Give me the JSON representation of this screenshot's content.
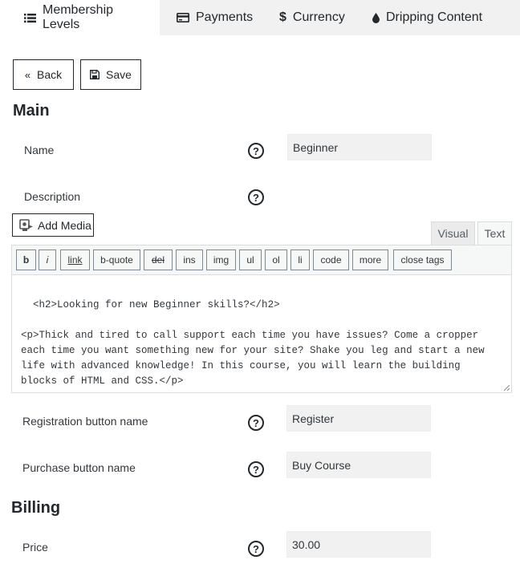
{
  "tabs": [
    {
      "label": "Membership Levels",
      "icon": "list-icon"
    },
    {
      "label": "Payments",
      "icon": "credit-card-icon"
    },
    {
      "label": "Currency",
      "icon": "dollar-icon"
    },
    {
      "label": "Dripping Content",
      "icon": "drop-icon"
    }
  ],
  "actions": {
    "back_label": "Back",
    "save_label": "Save"
  },
  "main": {
    "title": "Main",
    "name_label": "Name",
    "name_value": "Beginner",
    "description_label": "Description",
    "help_glyph": "?"
  },
  "editor": {
    "add_media_label": "Add Media",
    "tab_visual": "Visual",
    "tab_text": "Text",
    "quicktags": [
      "b",
      "i",
      "link",
      "b-quote",
      "del",
      "ins",
      "img",
      "ul",
      "ol",
      "li",
      "code",
      "more",
      "close tags"
    ],
    "content": "<h2>Looking for new Beginner skills?</h2>\n\n<p>Thick and tired to call support each time you have issues? Come a cropper each time you want something new for your site? Shake you leg and start a new life with advanced knowledge! In this course, you will learn the building blocks of HTML and CSS.</p>"
  },
  "registration": {
    "label": "Registration button name",
    "value": "Register"
  },
  "purchase": {
    "label": "Purchase button name",
    "value": "Buy Course"
  },
  "billing": {
    "title": "Billing",
    "price_label": "Price",
    "price_value": "30.00"
  }
}
